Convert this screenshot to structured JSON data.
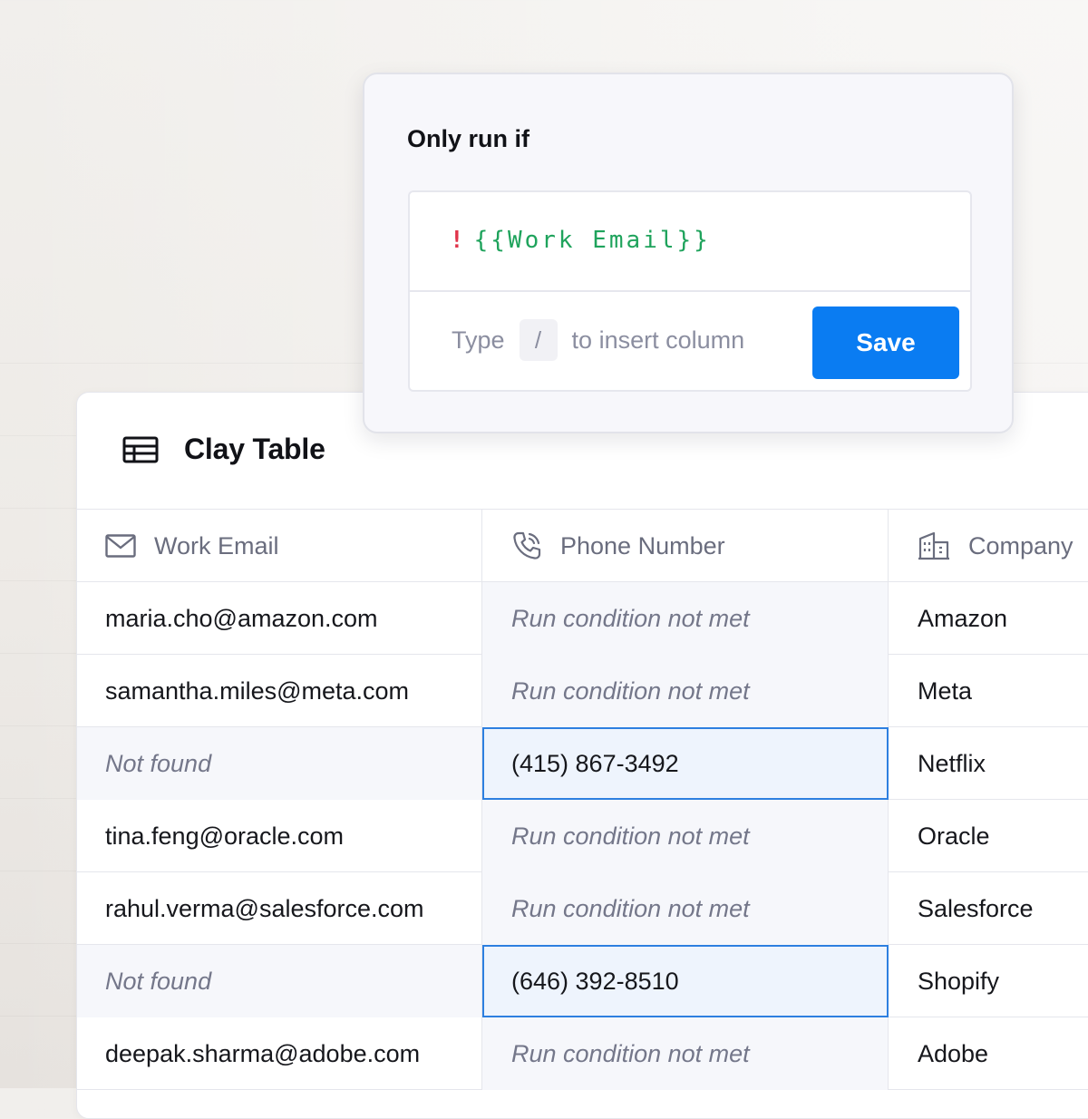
{
  "popover": {
    "title": "Only run if",
    "expression": {
      "operator": "!",
      "token": "{{Work Email}}"
    },
    "hint": {
      "prefix": "Type",
      "key": "/",
      "suffix": "to insert column"
    },
    "save_label": "Save"
  },
  "table": {
    "title": "Clay Table",
    "columns": [
      {
        "label": "Work Email",
        "icon": "mail-icon"
      },
      {
        "label": "Phone Number",
        "icon": "phone-icon"
      },
      {
        "label": "Company",
        "icon": "building-icon"
      }
    ],
    "rows": [
      {
        "email": "maria.cho@amazon.com",
        "phone": "Run condition not met",
        "company": "Amazon"
      },
      {
        "email": "samantha.miles@meta.com",
        "phone": "Run condition not met",
        "company": "Meta"
      },
      {
        "email": "Not found",
        "phone": "(415) 867-3492",
        "company": "Netflix"
      },
      {
        "email": "tina.feng@oracle.com",
        "phone": "Run condition not met",
        "company": "Oracle"
      },
      {
        "email": "rahul.verma@salesforce.com",
        "phone": "Run condition not met",
        "company": "Salesforce"
      },
      {
        "email": "Not found",
        "phone": "(646) 392-8510",
        "company": "Shopify"
      },
      {
        "email": "deepak.sharma@adobe.com",
        "phone": "Run condition not met",
        "company": "Adobe"
      }
    ]
  },
  "colors": {
    "accent": "#0a7cf2",
    "token_green": "#1fa35c",
    "operator_red": "#e0344a",
    "selection_border": "#2d7fe0"
  }
}
